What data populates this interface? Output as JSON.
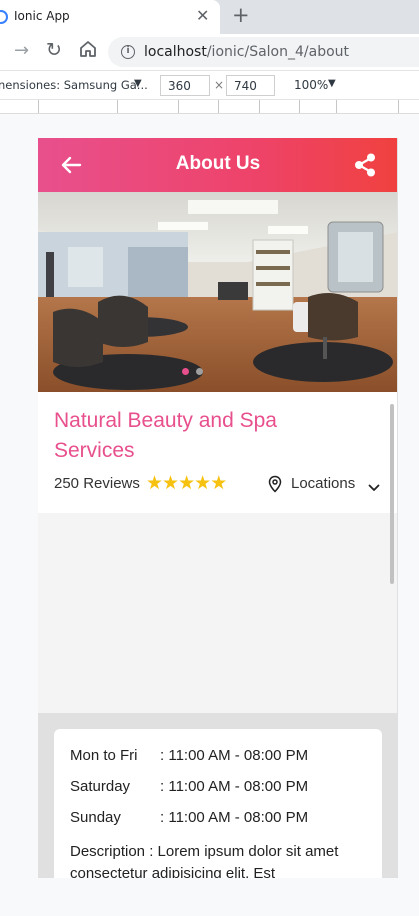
{
  "browser": {
    "tab_title": "Ionic App",
    "tab_close": "✕",
    "new_tab": "+",
    "url_host": "localhost",
    "url_path": "/ionic/Salon_4/about"
  },
  "devtools": {
    "device_label": "nensiones: Samsung Ga...",
    "width": "360",
    "height": "740",
    "times": "×",
    "zoom": "100%",
    "caret": "▼"
  },
  "app": {
    "header_title": "About Us",
    "salon_name": "Natural Beauty and Spa Services",
    "reviews": "250 Reviews",
    "rating": 5,
    "rating_max": 5,
    "location_label": "Locations",
    "carousel": {
      "current": 1,
      "total": 2
    },
    "hours": [
      {
        "day": "Mon to Fri",
        "time": ": 11:00 AM - 08:00 PM"
      },
      {
        "day": "Saturday",
        "time": ": 11:00 AM - 08:00 PM"
      },
      {
        "day": "Sunday",
        "time": ": 11:00 AM - 08:00 PM"
      }
    ],
    "description_label": "Description",
    "description_text": " : Lorem ipsum dolor sit amet consectetur adipisicing elit. Est"
  },
  "colors": {
    "primary": "#e8508d",
    "header_end": "#f0413f",
    "star": "#f6c20f"
  },
  "icons": {
    "back": "arrow-back-icon",
    "share": "share-icon",
    "location": "location-pin-icon",
    "chevron": "chevron-down-icon",
    "star": "star-icon"
  }
}
